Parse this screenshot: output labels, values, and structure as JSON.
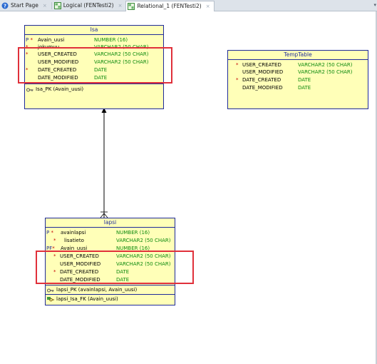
{
  "tabs": [
    {
      "label": "Start Page",
      "icon": "help-icon",
      "active": false
    },
    {
      "label": "Logical (FENTesti2)",
      "icon": "diagram-icon",
      "active": false
    },
    {
      "label": "Relational_1 (FENTesti2)",
      "icon": "diagram-icon",
      "active": true
    }
  ],
  "tab_close_glyph": "×",
  "entities": {
    "isa": {
      "title": "Isa",
      "columns": [
        {
          "marker": "P",
          "star": "*",
          "name": "Avain_uusi",
          "type": "NUMBER (16)"
        },
        {
          "marker": "",
          "star": "*",
          "name": "jokumuu",
          "type": "VARCHAR2 (50 CHAR)"
        },
        {
          "marker": "",
          "star": "*",
          "name": "USER_CREATED",
          "type": "VARCHAR2 (50 CHAR)"
        },
        {
          "marker": "",
          "star": "",
          "name": "USER_MODIFIED",
          "type": "VARCHAR2 (50 CHAR)"
        },
        {
          "marker": "",
          "star": "*",
          "name": "DATE_CREATED",
          "type": "DATE"
        },
        {
          "marker": "",
          "star": "",
          "name": "DATE_MODIFIED",
          "type": "DATE"
        }
      ],
      "keys": [
        {
          "label": "Isa_PK (Avain_uusi)",
          "icon": "primary-key-icon"
        }
      ]
    },
    "temptable": {
      "title": "TempTable",
      "columns": [
        {
          "marker": "",
          "star": "*",
          "name": "USER_CREATED",
          "type": "VARCHAR2 (50 CHAR)"
        },
        {
          "marker": "",
          "star": "",
          "name": "USER_MODIFIED",
          "type": "VARCHAR2 (50 CHAR)"
        },
        {
          "marker": "",
          "star": "*",
          "name": "DATE_CREATED",
          "type": "DATE"
        },
        {
          "marker": "",
          "star": "",
          "name": "DATE_MODIFIED",
          "type": "DATE"
        }
      ],
      "keys": []
    },
    "lapsi": {
      "title": "lapsi",
      "columns": [
        {
          "marker": "P",
          "star": "*",
          "name": "avainlapsi",
          "type": "NUMBER (16)"
        },
        {
          "marker": "",
          "star": "*",
          "name": "lisatieto",
          "type": "VARCHAR2 (50 CHAR)"
        },
        {
          "marker": "PF",
          "star": "*",
          "name": "Avain_uusi",
          "type": "NUMBER (16)"
        },
        {
          "marker": "",
          "star": "*",
          "name": "USER_CREATED",
          "type": "VARCHAR2 (50 CHAR)"
        },
        {
          "marker": "",
          "star": "",
          "name": "USER_MODIFIED",
          "type": "VARCHAR2 (50 CHAR)"
        },
        {
          "marker": "",
          "star": "*",
          "name": "DATE_CREATED",
          "type": "DATE"
        },
        {
          "marker": "",
          "star": "",
          "name": "DATE_MODIFIED",
          "type": "DATE"
        }
      ],
      "keys": [
        {
          "label": "lapsi_PK (avainlapsi, Avain_uusi)",
          "icon": "primary-key-icon"
        },
        {
          "label": "lapsi_Isa_FK (Avain_uusi)",
          "icon": "foreign-key-icon"
        }
      ]
    }
  },
  "colors": {
    "entity_fill": "#ffffb8",
    "entity_border": "#1f2b9a",
    "type_text": "#0e8a0e",
    "mandatory_star": "#c40000",
    "highlight_box": "#e0303a"
  }
}
